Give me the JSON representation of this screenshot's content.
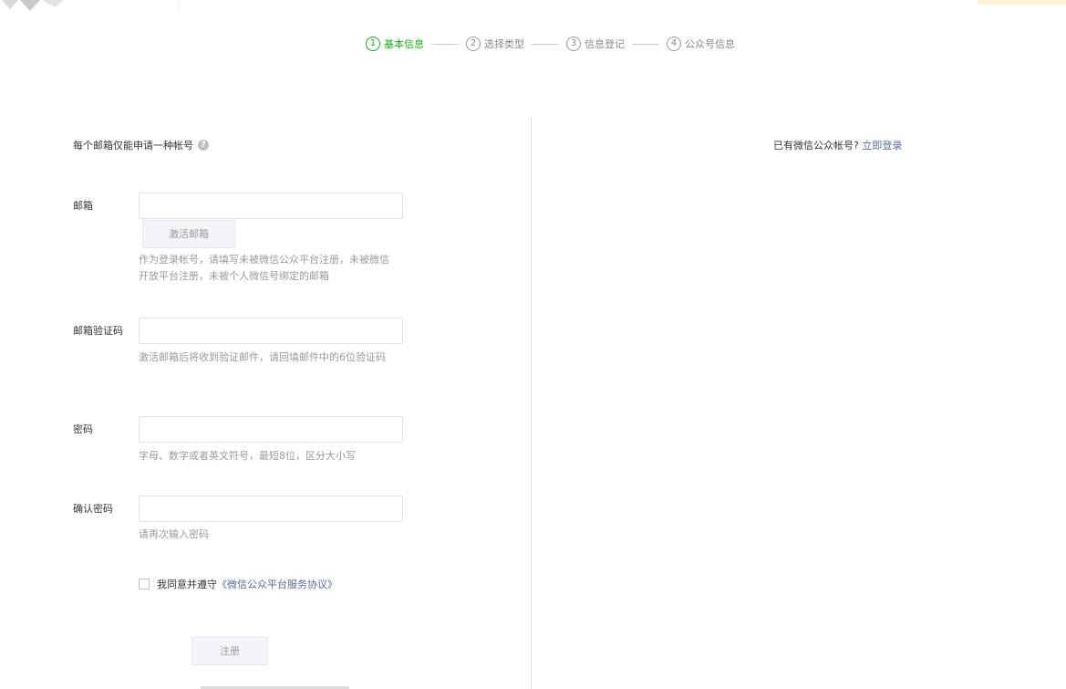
{
  "colors": {
    "accent": "#1aad19",
    "link": "#576b95",
    "hint": "#9a9a9a",
    "text": "#353535"
  },
  "steps": [
    {
      "num": "1",
      "label": "基本信息",
      "active": true
    },
    {
      "num": "2",
      "label": "选择类型",
      "active": false
    },
    {
      "num": "3",
      "label": "信息登记",
      "active": false
    },
    {
      "num": "4",
      "label": "公众号信息",
      "active": false
    }
  ],
  "form": {
    "notice": "每个邮箱仅能申请一种帐号",
    "help_icon": "question-circle-icon",
    "email": {
      "label": "邮箱",
      "value": "",
      "activate_button": "激活邮箱",
      "hint": "作为登录帐号，请填写未被微信公众平台注册，未被微信开放平台注册，未被个人微信号绑定的邮箱"
    },
    "email_code": {
      "label": "邮箱验证码",
      "value": "",
      "hint": "激活邮箱后将收到验证邮件，请回填邮件中的6位验证码"
    },
    "password": {
      "label": "密码",
      "value": "",
      "hint": "字母、数字或者英文符号，最短8位，区分大小写"
    },
    "confirm_password": {
      "label": "确认密码",
      "value": "",
      "hint": "请再次输入密码"
    },
    "agreement": {
      "prefix": "我同意并遵守",
      "link": "《微信公众平台服务协议》",
      "checked": false
    },
    "submit": "注册"
  },
  "side": {
    "prompt": "已有微信公众帐号?",
    "login_link": "立即登录"
  }
}
